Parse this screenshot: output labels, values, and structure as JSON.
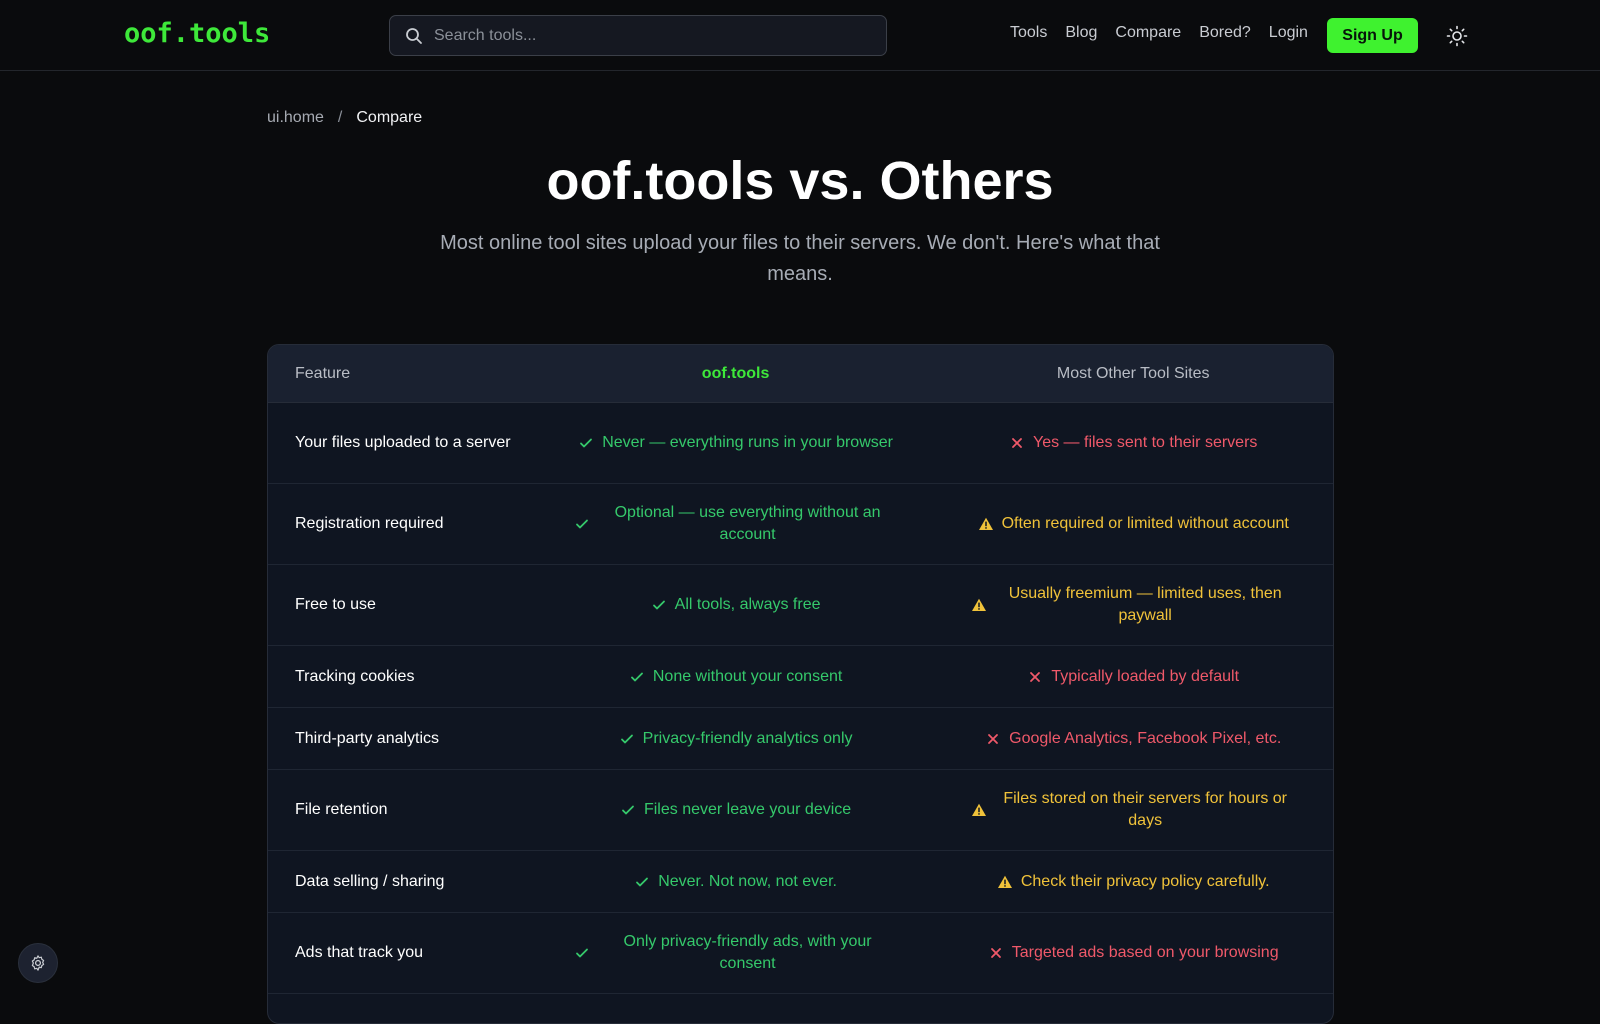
{
  "header": {
    "logo": "oof.tools",
    "search_placeholder": "Search tools...",
    "nav": [
      "Tools",
      "Blog",
      "Compare",
      "Bored?",
      "Login"
    ],
    "signup_label": "Sign Up"
  },
  "breadcrumb": {
    "home": "ui.home",
    "separator": "/",
    "current": "Compare"
  },
  "hero": {
    "title": "oof.tools vs. Others",
    "subtitle": "Most online tool sites upload your files to their servers. We don't. Here's what that means."
  },
  "table": {
    "headers": {
      "feature": "Feature",
      "ours": "oof.tools",
      "theirs": "Most Other Tool Sites"
    },
    "rows": [
      {
        "feature": "Your files uploaded to a server",
        "ours": "Never — everything runs in your browser",
        "ours_status": "check",
        "theirs": "Yes — files sent to their servers",
        "theirs_status": "cross"
      },
      {
        "feature": "Registration required",
        "ours": "Optional — use everything without an account",
        "ours_status": "check",
        "theirs": "Often required or limited without account",
        "theirs_status": "warning"
      },
      {
        "feature": "Free to use",
        "ours": "All tools, always free",
        "ours_status": "check",
        "theirs": "Usually freemium — limited uses, then paywall",
        "theirs_status": "warning"
      },
      {
        "feature": "Tracking cookies",
        "ours": "None without your consent",
        "ours_status": "check",
        "theirs": "Typically loaded by default",
        "theirs_status": "cross"
      },
      {
        "feature": "Third-party analytics",
        "ours": "Privacy-friendly analytics only",
        "ours_status": "check",
        "theirs": "Google Analytics, Facebook Pixel, etc.",
        "theirs_status": "cross"
      },
      {
        "feature": "File retention",
        "ours": "Files never leave your device",
        "ours_status": "check",
        "theirs": "Files stored on their servers for hours or days",
        "theirs_status": "warning"
      },
      {
        "feature": "Data selling / sharing",
        "ours": "Never. Not now, not ever.",
        "ours_status": "check",
        "theirs": "Check their privacy policy carefully.",
        "theirs_status": "warning"
      },
      {
        "feature": "Ads that track you",
        "ours": "Only privacy-friendly ads, with your consent",
        "ours_status": "check",
        "theirs": "Targeted ads based on your browsing",
        "theirs_status": "cross"
      }
    ]
  },
  "colors": {
    "brand_green": "#3ee83a",
    "check_green": "#35c96b",
    "cross_red": "#f0596a",
    "warning_yellow": "#f0c23a",
    "background": "#0a0b0d"
  },
  "icons": {
    "search": "search-icon",
    "theme": "sun-icon",
    "settings": "gear-icon",
    "check": "check-icon",
    "cross": "cross-icon",
    "warning": "warning-icon"
  }
}
